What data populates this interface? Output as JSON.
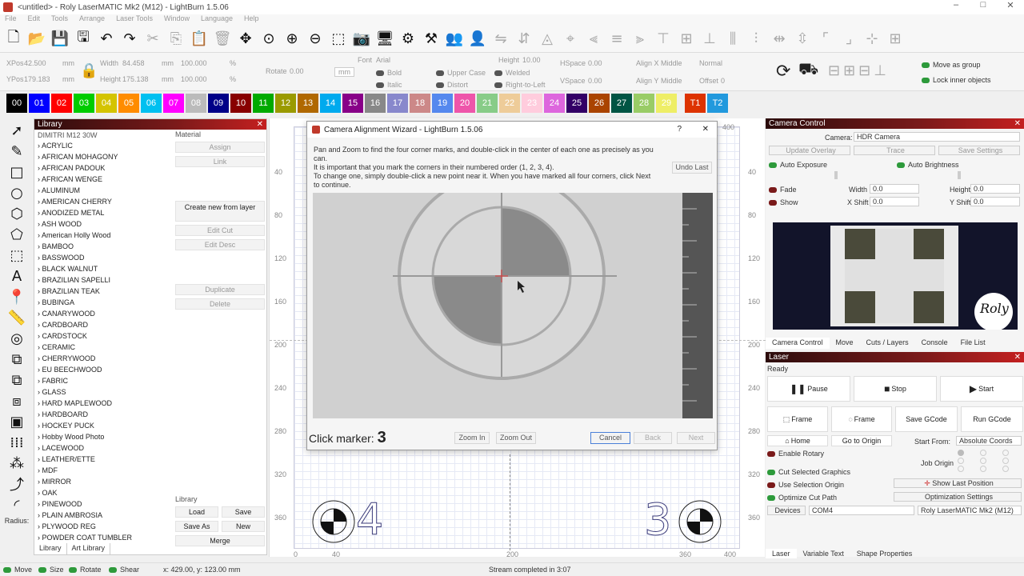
{
  "window": {
    "title": "<untitled> - Roly LaserMATIC Mk2 (M12) - LightBurn 1.5.06",
    "minimize": "–",
    "maximize": "□",
    "close": "✕"
  },
  "menu": [
    "File",
    "Edit",
    "Tools",
    "Arrange",
    "Laser Tools",
    "Window",
    "Language",
    "Help"
  ],
  "toolbar_icons": [
    "new-file-icon",
    "open-folder-icon",
    "save-icon",
    "save-as-icon",
    "undo-icon",
    "redo-icon",
    "cut-icon",
    "copy-icon",
    "paste-icon",
    "delete-icon",
    "move-icon",
    "zoom-fit-icon",
    "zoom-in-icon",
    "zoom-out-icon",
    "zoom-selection-icon",
    "camera-icon",
    "monitor-icon",
    "settings-icon",
    "tools-icon",
    "group-icon",
    "user-icon"
  ],
  "props": {
    "xpos_label": "XPos",
    "xpos": "42.500",
    "ypos_label": "YPos",
    "ypos": "179.183",
    "unit": "mm",
    "width_label": "Width",
    "width": "84.458",
    "height_label": "Height",
    "height": "175.138",
    "scale_w": "100.000",
    "scale_h": "100.000",
    "pct": "%",
    "rotate_label": "Rotate",
    "rotate": "0.00",
    "rot_unit": "mm",
    "font_label": "Font",
    "font": "Arial",
    "fheight_label": "Height",
    "fheight": "10.00",
    "hspace_label": "HSpace",
    "hspace": "0.00",
    "vspace_label": "VSpace",
    "vspace": "0.00",
    "alignx_label": "Align X",
    "alignx": "Middle",
    "aligny_label": "Align Y",
    "aligny": "Middle",
    "normal": "Normal",
    "offset_label": "Offset",
    "offset": "0",
    "bold": "Bold",
    "italic": "Italic",
    "upper": "Upper Case",
    "distort": "Distort",
    "welded": "Welded",
    "rtl": "Right-to-Left",
    "move_group": "Move as group",
    "lock_inner": "Lock inner objects"
  },
  "palette": [
    {
      "label": "00",
      "color": "#000000"
    },
    {
      "label": "01",
      "color": "#0000ff"
    },
    {
      "label": "02",
      "color": "#ff0000"
    },
    {
      "label": "03",
      "color": "#00cc00"
    },
    {
      "label": "04",
      "color": "#d4c400"
    },
    {
      "label": "05",
      "color": "#ff8c00"
    },
    {
      "label": "06",
      "color": "#00c0f0"
    },
    {
      "label": "07",
      "color": "#ff00ff"
    },
    {
      "label": "08",
      "color": "#bbbbbb"
    },
    {
      "label": "09",
      "color": "#000088"
    },
    {
      "label": "10",
      "color": "#880000"
    },
    {
      "label": "11",
      "color": "#00aa00"
    },
    {
      "label": "12",
      "color": "#9a9a00"
    },
    {
      "label": "13",
      "color": "#b06800"
    },
    {
      "label": "14",
      "color": "#00aaee"
    },
    {
      "label": "15",
      "color": "#880088"
    },
    {
      "label": "16",
      "color": "#888888"
    },
    {
      "label": "17",
      "color": "#8888cc"
    },
    {
      "label": "18",
      "color": "#cc8888"
    },
    {
      "label": "19",
      "color": "#5588ee"
    },
    {
      "label": "20",
      "color": "#ee55aa"
    },
    {
      "label": "21",
      "color": "#88cc88"
    },
    {
      "label": "22",
      "color": "#eecc99"
    },
    {
      "label": "23",
      "color": "#ffccdd"
    },
    {
      "label": "24",
      "color": "#dd66dd"
    },
    {
      "label": "25",
      "color": "#330066"
    },
    {
      "label": "26",
      "color": "#aa4400"
    },
    {
      "label": "27",
      "color": "#005544"
    },
    {
      "label": "28",
      "color": "#99cc66"
    },
    {
      "label": "29",
      "color": "#eeee66"
    },
    {
      "label": "T1",
      "color": "#dd3300"
    },
    {
      "label": "T2",
      "color": "#2299dd"
    }
  ],
  "left_tools": [
    "select-icon",
    "pen-icon",
    "rectangle-icon",
    "ellipse-icon",
    "polygon-icon",
    "edit-nodes-icon",
    "rect-select-icon",
    "text-icon",
    "position-icon",
    "measure-icon",
    "offset-icon",
    "boolean-union-icon",
    "boolean-subtract-icon",
    "boolean-intersect-icon",
    "weld-icon",
    "grid-array-icon",
    "circular-array-icon",
    "path-icon",
    "radius-icon"
  ],
  "left_tools_radius": "Radius:",
  "library": {
    "title": "Library",
    "device": "DIMITRI M12 30W",
    "material_label": "Material",
    "items": [
      "ACRYLIC",
      "AFRICAN MOHAGONY",
      "AFRICAN PADOUK",
      "AFRICAN WENGE",
      "ALUMINUM",
      "AMERICAN CHERRY",
      "ANODIZED METAL",
      "ASH WOOD",
      "American Holly Wood",
      "BAMBOO",
      "BASSWOOD",
      "BLACK WALNUT",
      "BRAZILIAN SAPELLI",
      "BRAZILIAN TEAK",
      "BUBINGA",
      "CANARYWOOD",
      "CARDBOARD",
      "CARDSTOCK",
      "CERAMIC",
      "CHERRYWOOD",
      "EU BEECHWOOD",
      "FABRIC",
      "GLASS",
      "HARD MAPLEWOOD",
      "HARDBOARD",
      "HOCKEY PUCK",
      "Hobby Wood Photo",
      "LACEWOOD",
      "LEATHER/ETTE",
      "MDF",
      "MIRROR",
      "OAK",
      "PINEWOOD",
      "PLAIN AMBROSIA",
      "PLYWOOD REG",
      "POWDER COAT TUMBLER"
    ],
    "assign": "Assign",
    "link": "Link",
    "create": "Create new from layer",
    "edit_cut": "Edit Cut",
    "edit_desc": "Edit Desc",
    "duplicate": "Duplicate",
    "delete": "Delete",
    "lib_label": "Library",
    "load": "Load",
    "save": "Save",
    "save_as": "Save As",
    "new": "New",
    "merge": "Merge",
    "tab_library": "Library",
    "tab_art": "Art Library"
  },
  "canvas": {
    "y_ticks": [
      "40",
      "80",
      "120",
      "160",
      "200",
      "240",
      "280",
      "320",
      "360"
    ],
    "x_ticks": [
      "0",
      "40",
      "200",
      "360",
      "400"
    ],
    "right_y_ticks": [
      "40",
      "80",
      "120",
      "160",
      "200",
      "240",
      "280",
      "320",
      "360"
    ],
    "marker_left": "4",
    "marker_right": "3",
    "top_right": "400"
  },
  "dialog": {
    "title": "Camera Alignment Wizard - LightBurn 1.5.06",
    "help": "?",
    "close": "✕",
    "line1": "Pan and Zoom to find the four corner marks, and double-click in the center of each one as precisely as you can.",
    "line2": "It is important that you mark the corners in their numbered order (1, 2, 3, 4).",
    "line3": "To change one, simply double-click a new point near it.  When you have marked all four corners, click Next to continue.",
    "undo": "Undo Last",
    "click_label": "Click marker:",
    "click_num": "3",
    "zoom_in": "Zoom In",
    "zoom_out": "Zoom Out",
    "cancel": "Cancel",
    "back": "Back",
    "next": "Next"
  },
  "camera": {
    "title": "Camera Control",
    "camera_label": "Camera:",
    "camera": "HDR Camera",
    "update": "Update Overlay",
    "trace": "Trace",
    "save_settings": "Save Settings",
    "auto_exp": "Auto Exposure",
    "auto_bright": "Auto Brightness",
    "fade": "Fade",
    "show": "Show",
    "width_label": "Width",
    "width": "0.0",
    "height_label": "Height",
    "height": "0.0",
    "xshift_label": "X Shift",
    "xshift": "0.0",
    "yshift_label": "Y Shift",
    "yshift": "0.0",
    "brand": "Roly",
    "tabs": [
      "Camera Control",
      "Move",
      "Cuts / Layers",
      "Console",
      "File List"
    ]
  },
  "laser": {
    "title": "Laser",
    "status": "Ready",
    "pause": "Pause",
    "stop": "Stop",
    "start": "Start",
    "frame1": "Frame",
    "frame2": "Frame",
    "save_gcode": "Save GCode",
    "run_gcode": "Run GCode",
    "home": "Home",
    "go_origin": "Go to Origin",
    "start_from_label": "Start From:",
    "start_from": "Absolute Coords",
    "enable_rotary": "Enable Rotary",
    "job_origin": "Job Origin",
    "cut_selected": "Cut Selected Graphics",
    "use_sel_origin": "Use Selection Origin",
    "show_last": "Show Last Position",
    "optimize": "Optimize Cut Path",
    "opt_settings": "Optimization Settings",
    "devices": "Devices",
    "port": "COM4",
    "device": "Roly LaserMATIC Mk2 (M12)",
    "tabs": [
      "Laser",
      "Variable Text",
      "Shape Properties"
    ]
  },
  "statusbar": {
    "move": "Move",
    "size": "Size",
    "rotate": "Rotate",
    "shear": "Shear",
    "coords": "x: 429.00, y: 123.00 mm",
    "msg": "Stream completed in 3:07"
  }
}
